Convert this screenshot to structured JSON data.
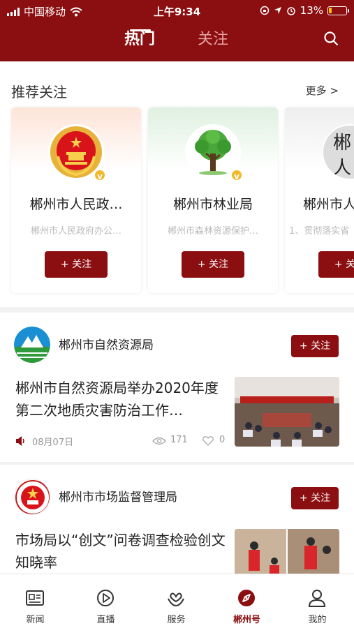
{
  "status_bar": {
    "carrier": "中国移动",
    "time": "上午9:34",
    "battery": "13%"
  },
  "header": {
    "tab_hot": "热门",
    "tab_follow": "关注",
    "search_icon": "search-icon"
  },
  "recommend": {
    "title": "推荐关注",
    "more": "更多 >",
    "cards": [
      {
        "name": "郴州市人民政…",
        "desc": "郴州市人民政府办公…",
        "follow": "+ 关注"
      },
      {
        "name": "郴州市林业局",
        "desc": "郴州市森林资源保护…",
        "follow": "+ 关注"
      },
      {
        "name": "郴州市人",
        "desc": "1、贯彻落实省",
        "follow": "+ 关注",
        "logo_text_1": "郴",
        "logo_text_2": "人"
      }
    ]
  },
  "feed": [
    {
      "source": "郴州市自然资源局",
      "follow": "+ 关注",
      "title": "郴州市自然资源局举办2020年度第二次地质灾害防治工作…",
      "date": "08月07日",
      "views": "171",
      "likes": "0"
    },
    {
      "source": "郴州市市场监督管理局",
      "follow": "+ 关注",
      "title": "市场局以“创文”问卷调查检验创文知晓率"
    }
  ],
  "bottom_nav": [
    {
      "label": "新闻",
      "icon": "news-icon"
    },
    {
      "label": "直播",
      "icon": "play-icon"
    },
    {
      "label": "服务",
      "icon": "service-icon"
    },
    {
      "label": "郴州号",
      "icon": "compass-icon"
    },
    {
      "label": "我的",
      "icon": "profile-icon"
    }
  ],
  "colors": {
    "brand": "#8b0e10",
    "active_nav": "#8b0e10"
  }
}
